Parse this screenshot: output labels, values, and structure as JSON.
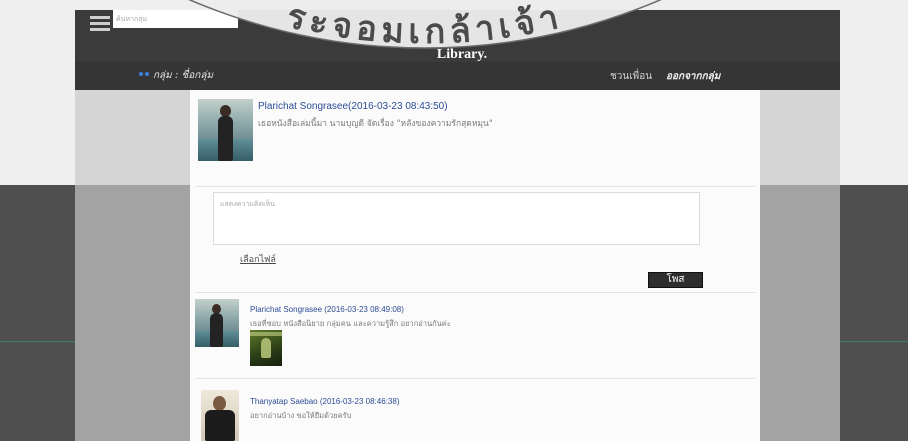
{
  "header": {
    "search_placeholder": "ค้นหากลุ่ม",
    "title": "Library.",
    "group_label": "กลุ่ม : ชื่อกลุ่ม",
    "nav": {
      "invite": "ชวนเพื่อน",
      "leave": "ออกจากกลุ่ม"
    }
  },
  "watermark": {
    "text": "ระจอมเกล้าเจ้า"
  },
  "icons": {
    "menu": "hamburger-icon",
    "group_bullet": "bullet-dots-icon"
  },
  "posts": [
    {
      "heading": "Plarichat Songrasee(2016-03-23 08:43:50)",
      "body": "เธอหนังสือเล่มนี้มา นามบุญดี จัดเรื่อง \"หลังของความรักสุดหมุน\""
    },
    {
      "heading": "Plarichat Songrasee (2016-03-23 08:49:08)",
      "body": "เธอที่ชอบ หนังสือนิยาย กลุ่มคน และความรู้สึก อยากอ่านกันค่ะ"
    },
    {
      "heading": "Thanyatap Saebao (2016-03-23 08:46:38)",
      "body": "อยากอ่านบ้าง ขอให้ยืมด้วยครับ"
    }
  ],
  "composer": {
    "placeholder": "แสดงความคิดเห็น",
    "file_link": "เลือกไฟล์",
    "submit_label": "โพส"
  },
  "colors": {
    "header_bg": "#3b3b3b",
    "link_blue": "#2c4d96",
    "bullet_blue": "#3c7fd8",
    "button_bg": "#2e2e2e"
  }
}
